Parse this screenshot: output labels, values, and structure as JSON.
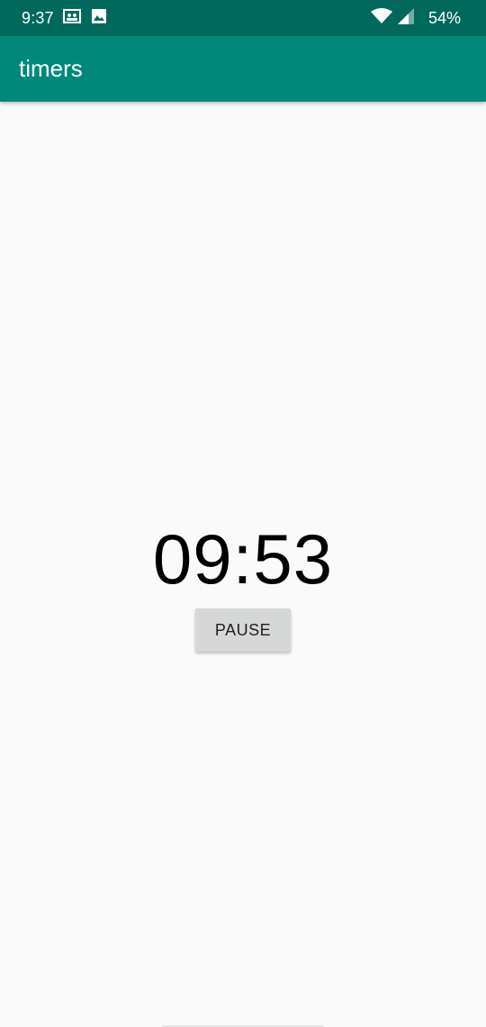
{
  "status_bar": {
    "time": "9:37",
    "left_icons": [
      "contacts-notification-icon",
      "image-notification-icon"
    ],
    "right_icons": [
      "wifi-icon",
      "cell-signal-icon"
    ],
    "battery": "54%"
  },
  "app_bar": {
    "title": "timers",
    "color": "#00897b",
    "status_color": "#00695c"
  },
  "timer": {
    "display": "09:53"
  },
  "controls": {
    "pause_label": "PAUSE"
  }
}
